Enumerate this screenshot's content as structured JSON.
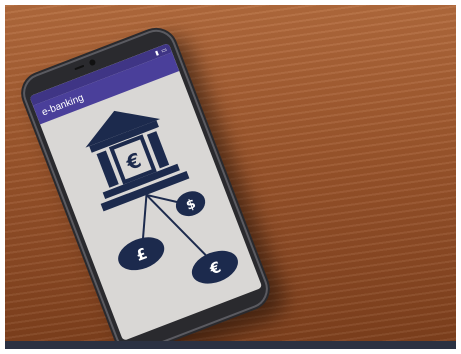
{
  "app": {
    "title": "e-banking"
  },
  "icons": {
    "bank": "bank-icon",
    "euro_bank": "euro-icon",
    "dollar": "dollar-icon",
    "pound": "pound-icon",
    "euro_coin": "euro-coin-icon"
  },
  "symbols": {
    "bank_currency": "€",
    "dollar": "$",
    "pound": "£",
    "euro": "€"
  },
  "colors": {
    "app_bar": "#4a3f9a",
    "icon_navy": "#1c2a4d",
    "screen_bg": "#d9d7d5"
  }
}
